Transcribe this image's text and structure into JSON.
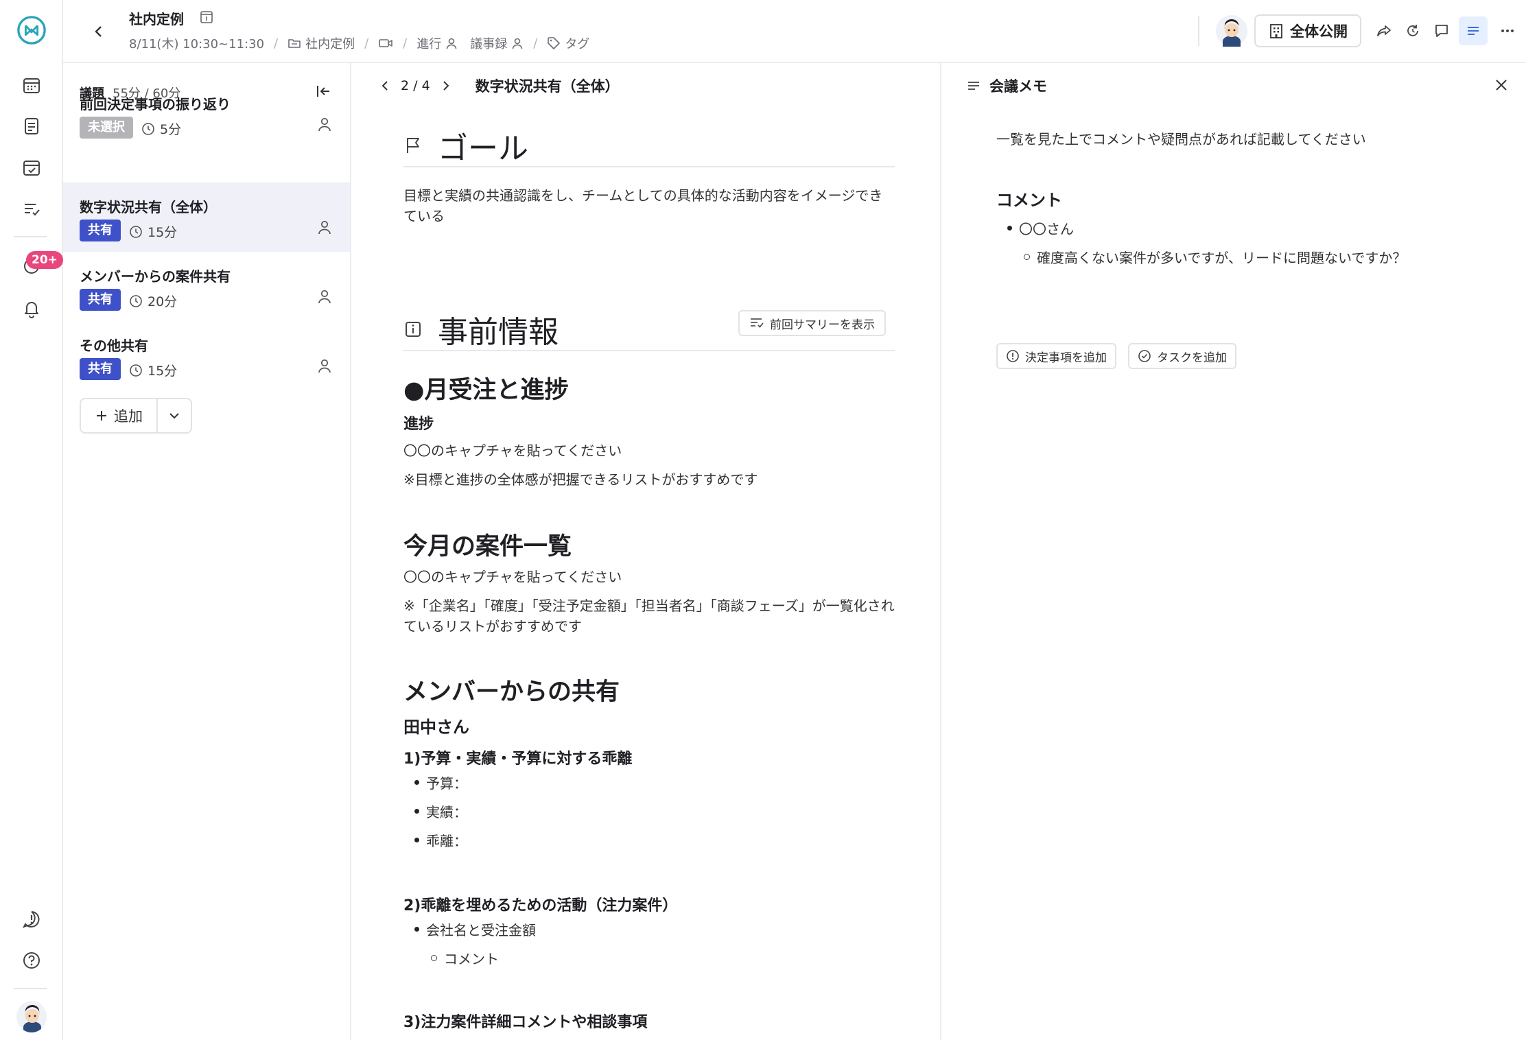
{
  "header": {
    "meeting_title": "社内定例",
    "datetime": "8/11(木) 10:30~11:30",
    "folder": "社内定例",
    "facilitator_label": "進行",
    "minutes_label": "議事録",
    "tag_label": "タグ",
    "publish_label": "全体公開"
  },
  "rail": {
    "notification_count": "20+"
  },
  "agenda": {
    "label": "議題",
    "time_summary": "55分 / 60分",
    "items": [
      {
        "title": "前回決定事項の振り返り",
        "tag": "未選択",
        "tag_color": "#b3b3b8",
        "duration": "5分"
      },
      {
        "title": "数字状況共有（全体）",
        "tag": "共有",
        "tag_color": "#3f51c8",
        "duration": "15分"
      },
      {
        "title": "メンバーからの案件共有",
        "tag": "共有",
        "tag_color": "#3f51c8",
        "duration": "20分"
      },
      {
        "title": "その他共有",
        "tag": "共有",
        "tag_color": "#3f51c8",
        "duration": "15分"
      }
    ],
    "add_label": "追加"
  },
  "main": {
    "pager": "2 / 4",
    "topic_title": "数字状況共有（全体）",
    "goal_heading": "ゴール",
    "goal_text": "目標と実績の共通認識をし、チームとしての具体的な活動内容をイメージできている",
    "pre_heading": "事前情報",
    "summary_button": "前回サマリーを表示",
    "s1_heading": "●月受注と進捗",
    "s1_sub": "進捗",
    "s1_p1": "〇〇のキャプチャを貼ってください",
    "s1_p2": "※目標と進捗の全体感が把握できるリストがおすすめです",
    "s2_heading": "今月の案件一覧",
    "s2_p1": "〇〇のキャプチャを貼ってください",
    "s2_p2": "※「企業名」「確度」「受注予定金額」「担当者名」「商談フェーズ」が一覧化されているリストがおすすめです",
    "s3_heading": "メンバーからの共有",
    "s3_member": "田中さん",
    "s3_h1": "1)予算・実績・予算に対する乖離",
    "s3_b1": "予算：",
    "s3_b2": "実績：",
    "s3_b3": "乖離：",
    "s3_h2": "2)乖離を埋めるための活動（注力案件）",
    "s3_b4": "会社名と受注金額",
    "s3_b5": "コメント",
    "s3_h3": "3)注力案件詳細コメントや相談事項"
  },
  "memo": {
    "title": "会議メモ",
    "instruction": "一覧を見た上でコメントや疑問点があれば記載してください",
    "comment_heading": "コメント",
    "bullet1": "〇〇さん",
    "bullet2": "確度高くない案件が多いですが、リードに問題ないですか？",
    "decision_button": "決定事項を追加",
    "task_button": "タスクを追加"
  },
  "colors": {
    "accent": "#3f51c8",
    "badge": "#e8467c",
    "logo": "#2aa5b8"
  }
}
